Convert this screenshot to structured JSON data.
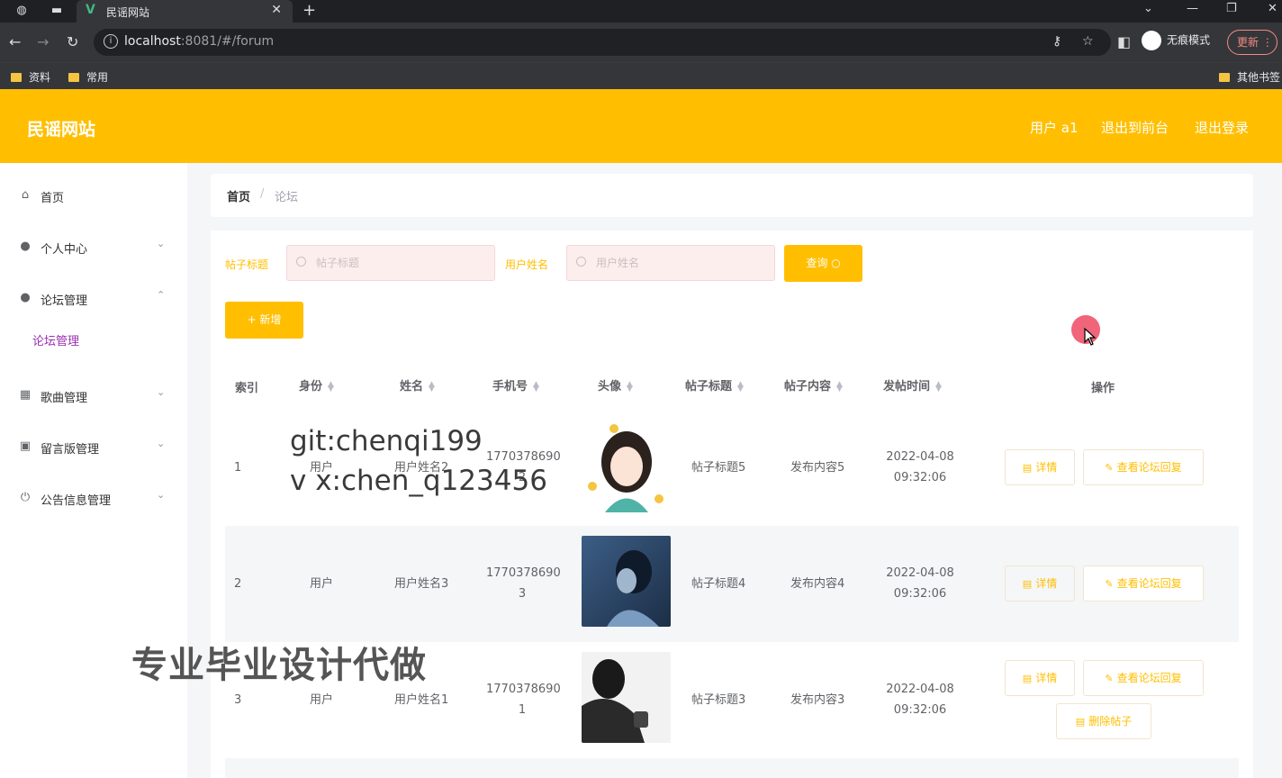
{
  "browser": {
    "tab_title": "民谣网站",
    "url_host": "localhost",
    "url_rest": ":8081/#/forum",
    "incognito_label": "无痕模式",
    "update_label": "更新",
    "bookmarks": [
      "资料",
      "常用"
    ],
    "other_bookmarks": "其他书签"
  },
  "header": {
    "brand": "民谣网站",
    "user": "用户 a1",
    "back_front": "退出到前台",
    "logout": "退出登录"
  },
  "sidebar": {
    "items": [
      {
        "label": "首页",
        "icon": "home-icon"
      },
      {
        "label": "个人中心",
        "icon": "user-icon"
      },
      {
        "label": "论坛管理",
        "icon": "bulb-icon"
      },
      {
        "label": "歌曲管理",
        "icon": "grid-icon"
      },
      {
        "label": "留言版管理",
        "icon": "clipboard-icon"
      },
      {
        "label": "公告信息管理",
        "icon": "power-icon"
      }
    ],
    "sub_active": "论坛管理"
  },
  "breadcrumb": {
    "home": "首页",
    "sep": "/",
    "current": "论坛"
  },
  "filters": {
    "title_label": "帖子标题",
    "title_placeholder": "帖子标题",
    "name_label": "用户姓名",
    "name_placeholder": "用户姓名",
    "query": "查询",
    "add": "+ 新增"
  },
  "table": {
    "headers": [
      "索引",
      "身份",
      "姓名",
      "手机号",
      "头像",
      "帖子标题",
      "帖子内容",
      "发帖时间",
      "操作"
    ],
    "rows": [
      {
        "index": "1",
        "role": "用户",
        "name": "用户姓名2",
        "phone1": "1770378690",
        "phone2": "2",
        "title": "帖子标题5",
        "content": "发布内容5",
        "date": "2022-04-08",
        "time": "09:32:06"
      },
      {
        "index": "2",
        "role": "用户",
        "name": "用户姓名3",
        "phone1": "1770378690",
        "phone2": "3",
        "title": "帖子标题4",
        "content": "发布内容4",
        "date": "2022-04-08",
        "time": "09:32:06"
      },
      {
        "index": "3",
        "role": "用户",
        "name": "用户姓名1",
        "phone1": "1770378690",
        "phone2": "1",
        "title": "帖子标题3",
        "content": "发布内容3",
        "date": "2022-04-08",
        "time": "09:32:06"
      }
    ],
    "actions": {
      "detail": "详情",
      "view_reply": "查看论坛回复",
      "delete": "删除帖子"
    }
  },
  "watermark": {
    "line1": "git:chenqi199",
    "line2": "v x:chen_q123456",
    "banner": "专业毕业设计代做"
  }
}
